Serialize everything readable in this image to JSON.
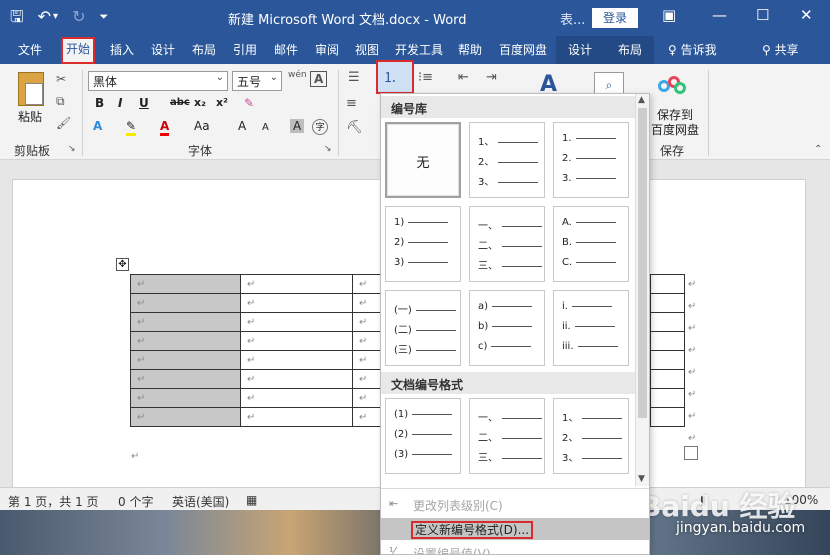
{
  "window": {
    "title": "新建 Microsoft Word 文档.docx  -  Word",
    "context_title": "表...",
    "login": "登录",
    "controls": [
      "—",
      "☐",
      "✕"
    ]
  },
  "qat": {
    "save": "🖫",
    "undo": "↶",
    "undo_drop": "▾",
    "redo": "↻",
    "customize": "⏷"
  },
  "tabs": [
    {
      "label": "文件"
    },
    {
      "label": "开始"
    },
    {
      "label": "插入"
    },
    {
      "label": "设计"
    },
    {
      "label": "布局"
    },
    {
      "label": "引用"
    },
    {
      "label": "邮件"
    },
    {
      "label": "审阅"
    },
    {
      "label": "视图"
    },
    {
      "label": "开发工具"
    },
    {
      "label": "帮助"
    },
    {
      "label": "百度网盘"
    },
    {
      "label": "设计"
    },
    {
      "label": "布局"
    }
  ],
  "tell_me": "告诉我",
  "share": "共享",
  "ribbon": {
    "paste": "粘贴",
    "clipboard_group": "剪贴板",
    "font_name": "黑体",
    "font_size": "五号",
    "font_group": "字体",
    "font_buttons": [
      "B",
      "I",
      "U",
      "abc",
      "x₂",
      "x²"
    ],
    "font_buttons_row3": [
      "A",
      "A",
      "Aa",
      "A",
      "A",
      "A",
      "字"
    ],
    "wen": "wén",
    "boxed_a": "A",
    "save_cloud_line1": "保存到",
    "save_cloud_line2": "百度网盘",
    "save_group": "保存",
    "styles_icon": "A",
    "find_icon": "⌕"
  },
  "numbering_panel": {
    "library_header": "编号库",
    "none_label": "无",
    "tiles": [
      [
        "1、",
        "2、",
        "3、"
      ],
      [
        "1.",
        "2.",
        "3."
      ],
      [
        "1)",
        "2)",
        "3)"
      ],
      [
        "一、",
        "二、",
        "三、"
      ],
      [
        "A.",
        "B.",
        "C."
      ],
      [
        "(一)",
        "(二)",
        "(三)"
      ],
      [
        "a)",
        "b)",
        "c)"
      ],
      [
        "i.",
        "ii.",
        "iii."
      ]
    ],
    "doc_header": "文档编号格式",
    "doc_tiles": [
      [
        "(1)",
        "(2)",
        "(3)"
      ],
      [
        "一、",
        "二、",
        "三、"
      ],
      [
        "1、",
        "2、",
        "3、"
      ]
    ],
    "menu": {
      "change_level": "更改列表级别(C)",
      "define_new": "定义新编号格式(D)...",
      "set_value": "设置编号值(V)..."
    }
  },
  "document": {
    "para_mark": "↵",
    "move_handle": "✥"
  },
  "status": {
    "page": "第 1 页，共 1 页",
    "words": "0 个字",
    "language": "英语(美国)",
    "zoom": "100%"
  },
  "watermark": {
    "logo": "Baidu 经验",
    "url": "jingyan.baidu.com"
  }
}
